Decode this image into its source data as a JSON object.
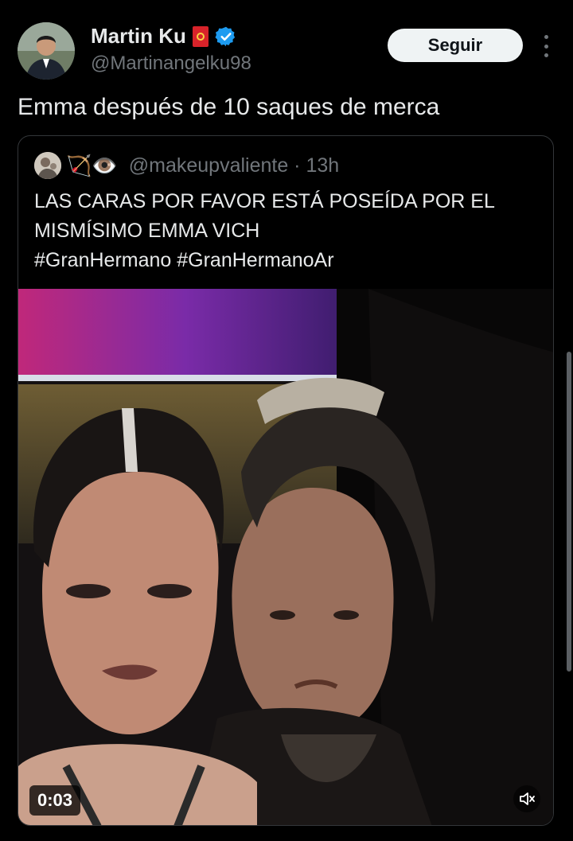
{
  "author": {
    "display_name": "Martin Ku",
    "handle": "@Martinangelku98",
    "avatar_icon": "profile-photo-avatar",
    "badge_icons": [
      "flag-emoji-icon",
      "verified-badge-icon"
    ]
  },
  "actions": {
    "follow_label": "Seguir",
    "more_icon": "vertical-ellipsis-icon"
  },
  "tweet": {
    "text": "Emma después de 10 saques de merca"
  },
  "quote": {
    "emojis": "🏹👁️",
    "handle": "@makeupvaliente",
    "time": "13h",
    "meta": "@makeupvaliente · 13h",
    "lines": [
      "LAS CARAS POR FAVOR ESTÁ POSEÍDA POR EL",
      "MISMÍSIMO EMMA VICH",
      "#GranHermano #GranHermanoAr"
    ],
    "media": {
      "duration": "0:03",
      "sound_icon": "speaker-muted-icon"
    }
  },
  "colors": {
    "background": "#000000",
    "text": "#e7e9ea",
    "muted": "#71767b",
    "verified": "#1d9bf0",
    "border": "#333639"
  }
}
